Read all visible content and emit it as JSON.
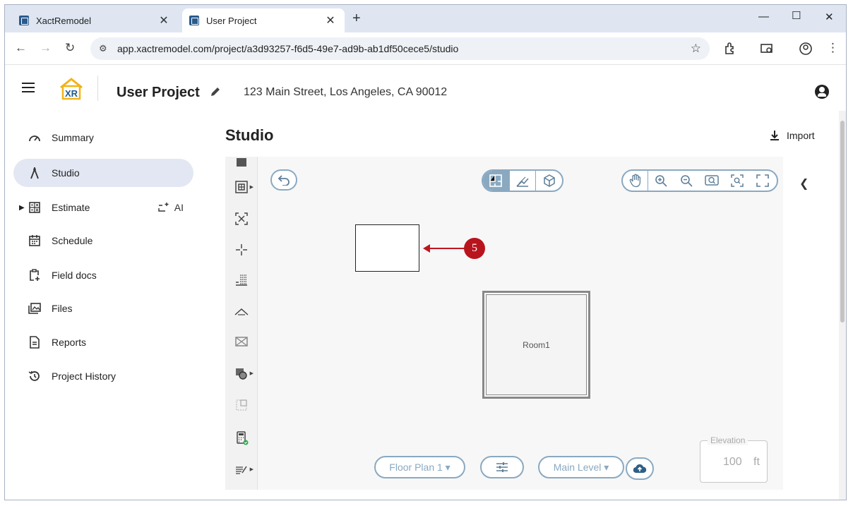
{
  "browser": {
    "tabs": [
      {
        "title": "XactRemodel",
        "active": false
      },
      {
        "title": "User Project",
        "active": true
      }
    ],
    "url": "app.xactremodel.com/project/a3d93257-f6d5-49e7-ad9b-ab1df50cece5/studio"
  },
  "header": {
    "logo_text": "XR",
    "project_title": "User Project",
    "address": "123 Main Street, Los Angeles, CA 90012"
  },
  "sidebar": {
    "items": [
      {
        "label": "Summary"
      },
      {
        "label": "Studio"
      },
      {
        "label": "Estimate",
        "extra": "AI"
      },
      {
        "label": "Schedule"
      },
      {
        "label": "Field docs"
      },
      {
        "label": "Files"
      },
      {
        "label": "Reports"
      },
      {
        "label": "Project History"
      }
    ]
  },
  "studio": {
    "title": "Studio",
    "import_label": "Import",
    "room_label": "Room1",
    "callout_number": "5",
    "floor_plan_label": "Floor Plan 1 ▾",
    "level_label": "Main Level ▾",
    "elevation": {
      "label": "Elevation",
      "value": "100",
      "unit": "ft"
    }
  },
  "colors": {
    "accent": "#8aa9c1",
    "callout": "#b8141d",
    "active_nav": "#e2e7f3"
  }
}
